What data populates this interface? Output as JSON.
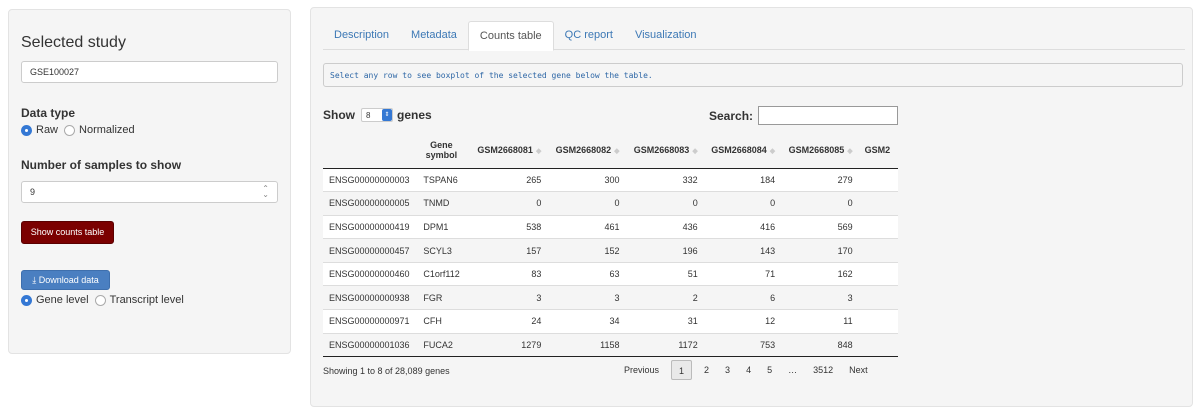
{
  "sidebar": {
    "title": "Selected study",
    "study_value": "GSE100027",
    "data_type_label": "Data type",
    "data_type_options": [
      "Raw",
      "Normalized"
    ],
    "data_type_selected": "Raw",
    "samples_label": "Number of samples to show",
    "samples_value": "9",
    "show_counts_label": "Show counts table",
    "download_label": "Download data",
    "level_options": [
      "Gene level",
      "Transcript level"
    ],
    "level_selected": "Gene level"
  },
  "tabs": [
    {
      "label": "Description",
      "active": false
    },
    {
      "label": "Metadata",
      "active": false
    },
    {
      "label": "Counts table",
      "active": true
    },
    {
      "label": "QC report",
      "active": false
    },
    {
      "label": "Visualization",
      "active": false
    }
  ],
  "info_message": "Select any row to see boxplot of the selected gene below the table.",
  "table_controls": {
    "show_label": "Show",
    "length_value": "8",
    "genes_label": "genes",
    "search_label": "Search:"
  },
  "table": {
    "columns": [
      "",
      "Gene symbol",
      "GSM2668081",
      "GSM2668082",
      "GSM2668083",
      "GSM2668084",
      "GSM2668085",
      "GSM2"
    ],
    "rows": [
      [
        "ENSG00000000003",
        "TSPAN6",
        "265",
        "300",
        "332",
        "184",
        "279"
      ],
      [
        "ENSG00000000005",
        "TNMD",
        "0",
        "0",
        "0",
        "0",
        "0"
      ],
      [
        "ENSG00000000419",
        "DPM1",
        "538",
        "461",
        "436",
        "416",
        "569"
      ],
      [
        "ENSG00000000457",
        "SCYL3",
        "157",
        "152",
        "196",
        "143",
        "170"
      ],
      [
        "ENSG00000000460",
        "C1orf112",
        "83",
        "63",
        "51",
        "71",
        "162"
      ],
      [
        "ENSG00000000938",
        "FGR",
        "3",
        "3",
        "2",
        "6",
        "3"
      ],
      [
        "ENSG00000000971",
        "CFH",
        "24",
        "34",
        "31",
        "12",
        "11"
      ],
      [
        "ENSG00000001036",
        "FUCA2",
        "1279",
        "1158",
        "1172",
        "753",
        "848"
      ]
    ]
  },
  "footer": {
    "info": "Showing 1 to 8 of 28,089 genes",
    "pagination": [
      "Previous",
      "1",
      "2",
      "3",
      "4",
      "5",
      "…",
      "3512",
      "Next"
    ],
    "current_page": "1"
  },
  "colors": {
    "show_counts_button": "#7b0000",
    "download_button": "#4a7fc1",
    "link_blue": "#3c78b5"
  }
}
